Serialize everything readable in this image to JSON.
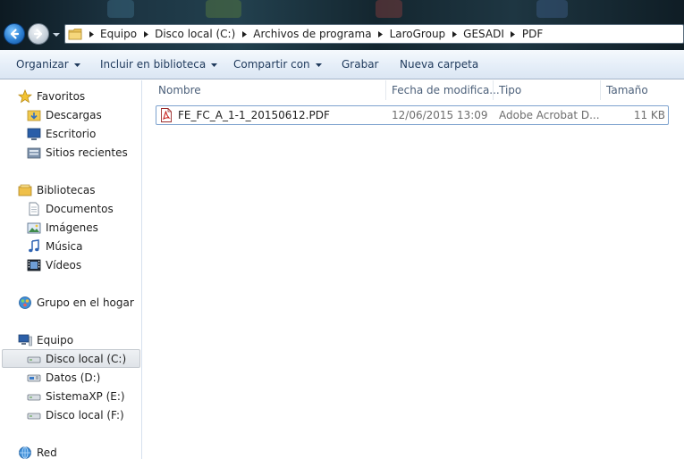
{
  "address": {
    "breadcrumbs": [
      "Equipo",
      "Disco local (C:)",
      "Archivos de programa",
      "LaroGroup",
      "GESADI",
      "PDF"
    ]
  },
  "toolbar": {
    "organize_label": "Organizar",
    "include_library_label": "Incluir en biblioteca",
    "share_label": "Compartir con",
    "burn_label": "Grabar",
    "new_folder_label": "Nueva carpeta"
  },
  "nav": {
    "favorites": {
      "label": "Favoritos",
      "items": [
        {
          "label": "Descargas",
          "icon": "downloads-folder-icon"
        },
        {
          "label": "Escritorio",
          "icon": "desktop-icon"
        },
        {
          "label": "Sitios recientes",
          "icon": "recent-places-icon"
        }
      ]
    },
    "libraries": {
      "label": "Bibliotecas",
      "items": [
        {
          "label": "Documentos",
          "icon": "documents-icon"
        },
        {
          "label": "Imágenes",
          "icon": "pictures-icon"
        },
        {
          "label": "Música",
          "icon": "music-icon"
        },
        {
          "label": "Vídeos",
          "icon": "videos-icon"
        }
      ]
    },
    "homegroup": {
      "label": "Grupo en el hogar"
    },
    "computer": {
      "label": "Equipo",
      "items": [
        {
          "label": "Disco local (C:)",
          "icon": "drive-icon",
          "selected": true
        },
        {
          "label": "Datos (D:)",
          "icon": "network-drive-icon"
        },
        {
          "label": "SistemaXP (E:)",
          "icon": "drive-icon"
        },
        {
          "label": "Disco local (F:)",
          "icon": "drive-icon"
        }
      ]
    },
    "network": {
      "label": "Red"
    }
  },
  "columns": {
    "name": "Nombre",
    "date_modified": "Fecha de modifica...",
    "type": "Tipo",
    "size": "Tamaño"
  },
  "files": [
    {
      "name": "FE_FC_A_1-1_20150612.PDF",
      "date_modified": "12/06/2015 13:09",
      "type": "Adobe Acrobat D...",
      "size": "11 KB",
      "icon": "pdf-file-icon"
    }
  ],
  "colors": {
    "selection_border": "#7da2ce",
    "toolbar_text": "#1e395b",
    "column_header_text": "#4c607a",
    "meta_text": "#6d6d6d"
  }
}
